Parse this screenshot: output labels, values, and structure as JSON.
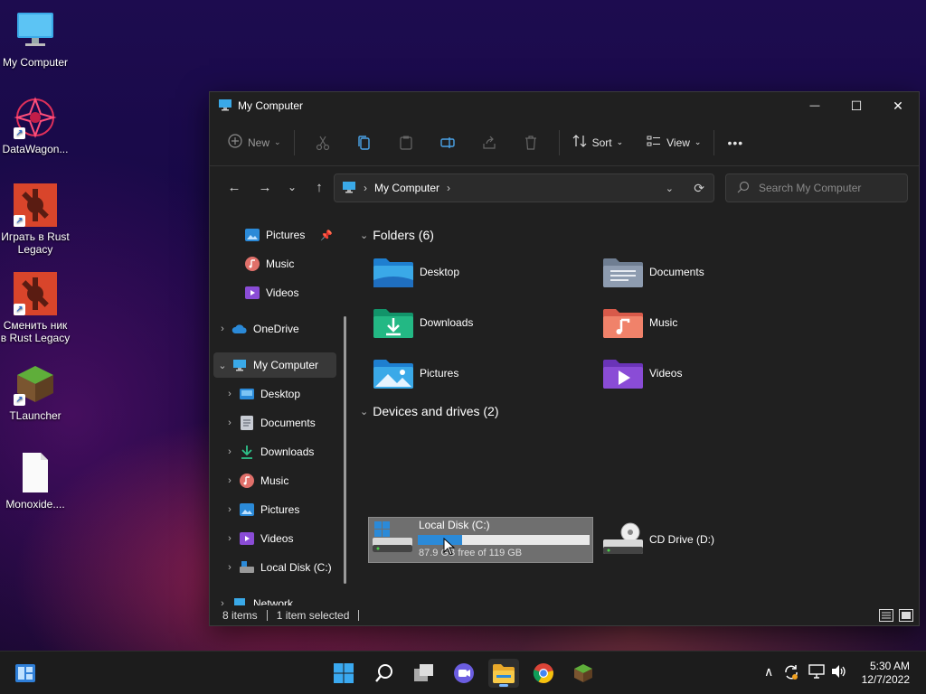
{
  "desktop": {
    "icons": [
      {
        "label": "My Computer"
      },
      {
        "label": "DataWagon..."
      },
      {
        "label": "Играть в Rust Legacy"
      },
      {
        "label": "Сменить ник в Rust Legacy"
      },
      {
        "label": "TLauncher"
      },
      {
        "label": "Monoxide...."
      }
    ]
  },
  "window": {
    "title": "My Computer",
    "controls": {
      "minimize": "—",
      "maximize": "☐",
      "close": "✕"
    },
    "toolbar": {
      "new_label": "New",
      "sort_label": "Sort",
      "view_label": "View",
      "more_label": "•••"
    },
    "nav": {
      "back": "←",
      "forward": "→",
      "recent": "⌄",
      "up": "↑"
    },
    "address": {
      "crumb": "My Computer",
      "separator": "›",
      "refresh": "⟳"
    },
    "search": {
      "placeholder": "Search My Computer"
    },
    "nav_pane": {
      "items": [
        {
          "label": "Pictures"
        },
        {
          "label": "Music"
        },
        {
          "label": "Videos"
        },
        {
          "label": "OneDrive"
        },
        {
          "label": "My Computer"
        },
        {
          "label": "Desktop"
        },
        {
          "label": "Documents"
        },
        {
          "label": "Downloads"
        },
        {
          "label": "Music"
        },
        {
          "label": "Pictures"
        },
        {
          "label": "Videos"
        },
        {
          "label": "Local Disk (C:)"
        },
        {
          "label": "Network"
        }
      ]
    },
    "folders": {
      "header": "Folders (6)",
      "items": [
        {
          "label": "Desktop"
        },
        {
          "label": "Documents"
        },
        {
          "label": "Downloads"
        },
        {
          "label": "Music"
        },
        {
          "label": "Pictures"
        },
        {
          "label": "Videos"
        }
      ]
    },
    "drives": {
      "header": "Devices and drives (2)",
      "items": [
        {
          "label": "Local Disk (C:)",
          "free_text": "87.9 GB free of 119 GB",
          "used_fraction": 0.26
        },
        {
          "label": "CD Drive (D:)"
        }
      ]
    },
    "status": {
      "items_count": "8 items",
      "selected": "1 item selected"
    }
  },
  "taskbar": {
    "clock": {
      "time": "5:30 AM",
      "date": "12/7/2022"
    },
    "tray": {
      "chevron": "∧"
    }
  },
  "colors": {
    "accent": "#2b8ad8",
    "window_bg": "#202020",
    "taskbar_bg": "#1c1c1c"
  }
}
